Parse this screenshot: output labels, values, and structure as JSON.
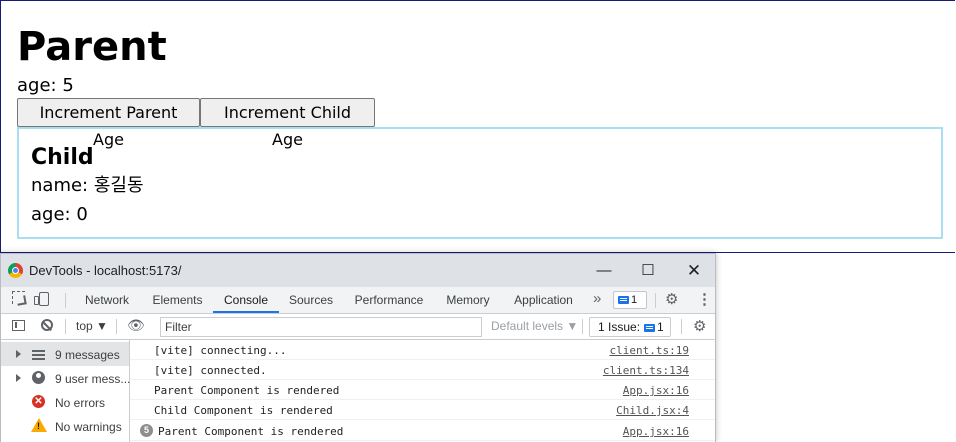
{
  "app": {
    "parent_title": "Parent",
    "parent_age_label": "age: 5",
    "buttons": {
      "increment_parent": "Increment Parent Age",
      "increment_child": "Increment Child Age"
    },
    "child": {
      "title": "Child",
      "name_label": "name: 홍길동",
      "age_label": "age: 0"
    }
  },
  "devtools": {
    "window_title": "DevTools - localhost:5173/",
    "window_controls": {
      "minimize": "—",
      "maximize": "☐",
      "close": "✕"
    },
    "tabs": [
      "Network",
      "Elements",
      "Console",
      "Sources",
      "Performance",
      "Memory",
      "Application"
    ],
    "active_tab": "Console",
    "more_tabs": "»",
    "issues_badge_count": "1",
    "toolbar": {
      "context": "top ▼",
      "filter_placeholder": "Filter",
      "levels": "Default levels ▼",
      "issues_label": "1 Issue:",
      "issues_count": "1"
    },
    "sidebar": {
      "items": [
        {
          "label": "9 messages",
          "icon": "list-icon"
        },
        {
          "label": "9 user mess...",
          "icon": "user-icon"
        },
        {
          "label": "No errors",
          "icon": "error-icon"
        },
        {
          "label": "No warnings",
          "icon": "warning-icon"
        }
      ]
    },
    "console_rows": [
      {
        "message": "[vite] connecting...",
        "source": "client.ts:19"
      },
      {
        "message": "[vite] connected.",
        "source": "client.ts:134"
      },
      {
        "message": "Parent Component is rendered",
        "source": "App.jsx:16"
      },
      {
        "message": "Child Component is rendered",
        "source": "Child.jsx:4"
      },
      {
        "message": "Parent Component is rendered",
        "source": "App.jsx:16",
        "repeat": "5"
      }
    ]
  }
}
